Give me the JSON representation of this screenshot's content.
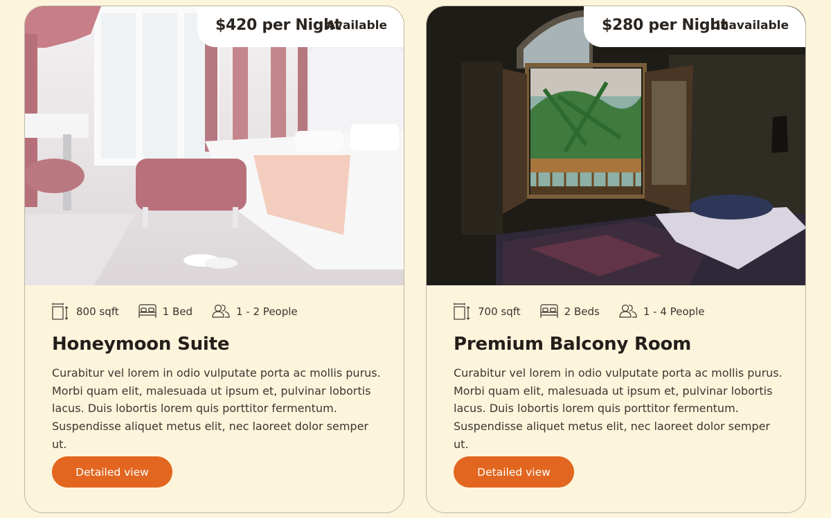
{
  "rooms": [
    {
      "price": "$420 per Night",
      "status": "Available",
      "size": "800 sqft",
      "beds": "1 Bed",
      "people": "1 - 2 People",
      "title": "Honeymoon Suite",
      "description": "Curabitur vel lorem in odio vulputate porta ac mollis purus. Morbi quam elit, malesuada ut ipsum et, pulvinar lobortis lacus. Duis lobortis lorem quis porttitor fermentum. Suspendisse aliquet metus elit, nec laoreet dolor semper ut.",
      "button": "Detailed view"
    },
    {
      "price": "$280 per Night",
      "status": "Unavailable",
      "size": "700 sqft",
      "beds": "2 Beds",
      "people": "1 - 4 People",
      "title": "Premium Balcony Room",
      "description": "Curabitur vel lorem in odio vulputate porta ac mollis purus. Morbi quam elit, malesuada ut ipsum et, pulvinar lobortis lacus. Duis lobortis lorem quis porttitor fermentum. Suspendisse aliquet metus elit, nec laoreet dolor semper ut.",
      "button": "Detailed view"
    }
  ],
  "icons": {
    "size": "room-size-icon",
    "beds": "bed-icon",
    "people": "people-icon"
  },
  "colors": {
    "background": "#fdf4dc",
    "accent": "#e2661f",
    "card_border": "#bdb6a6"
  }
}
